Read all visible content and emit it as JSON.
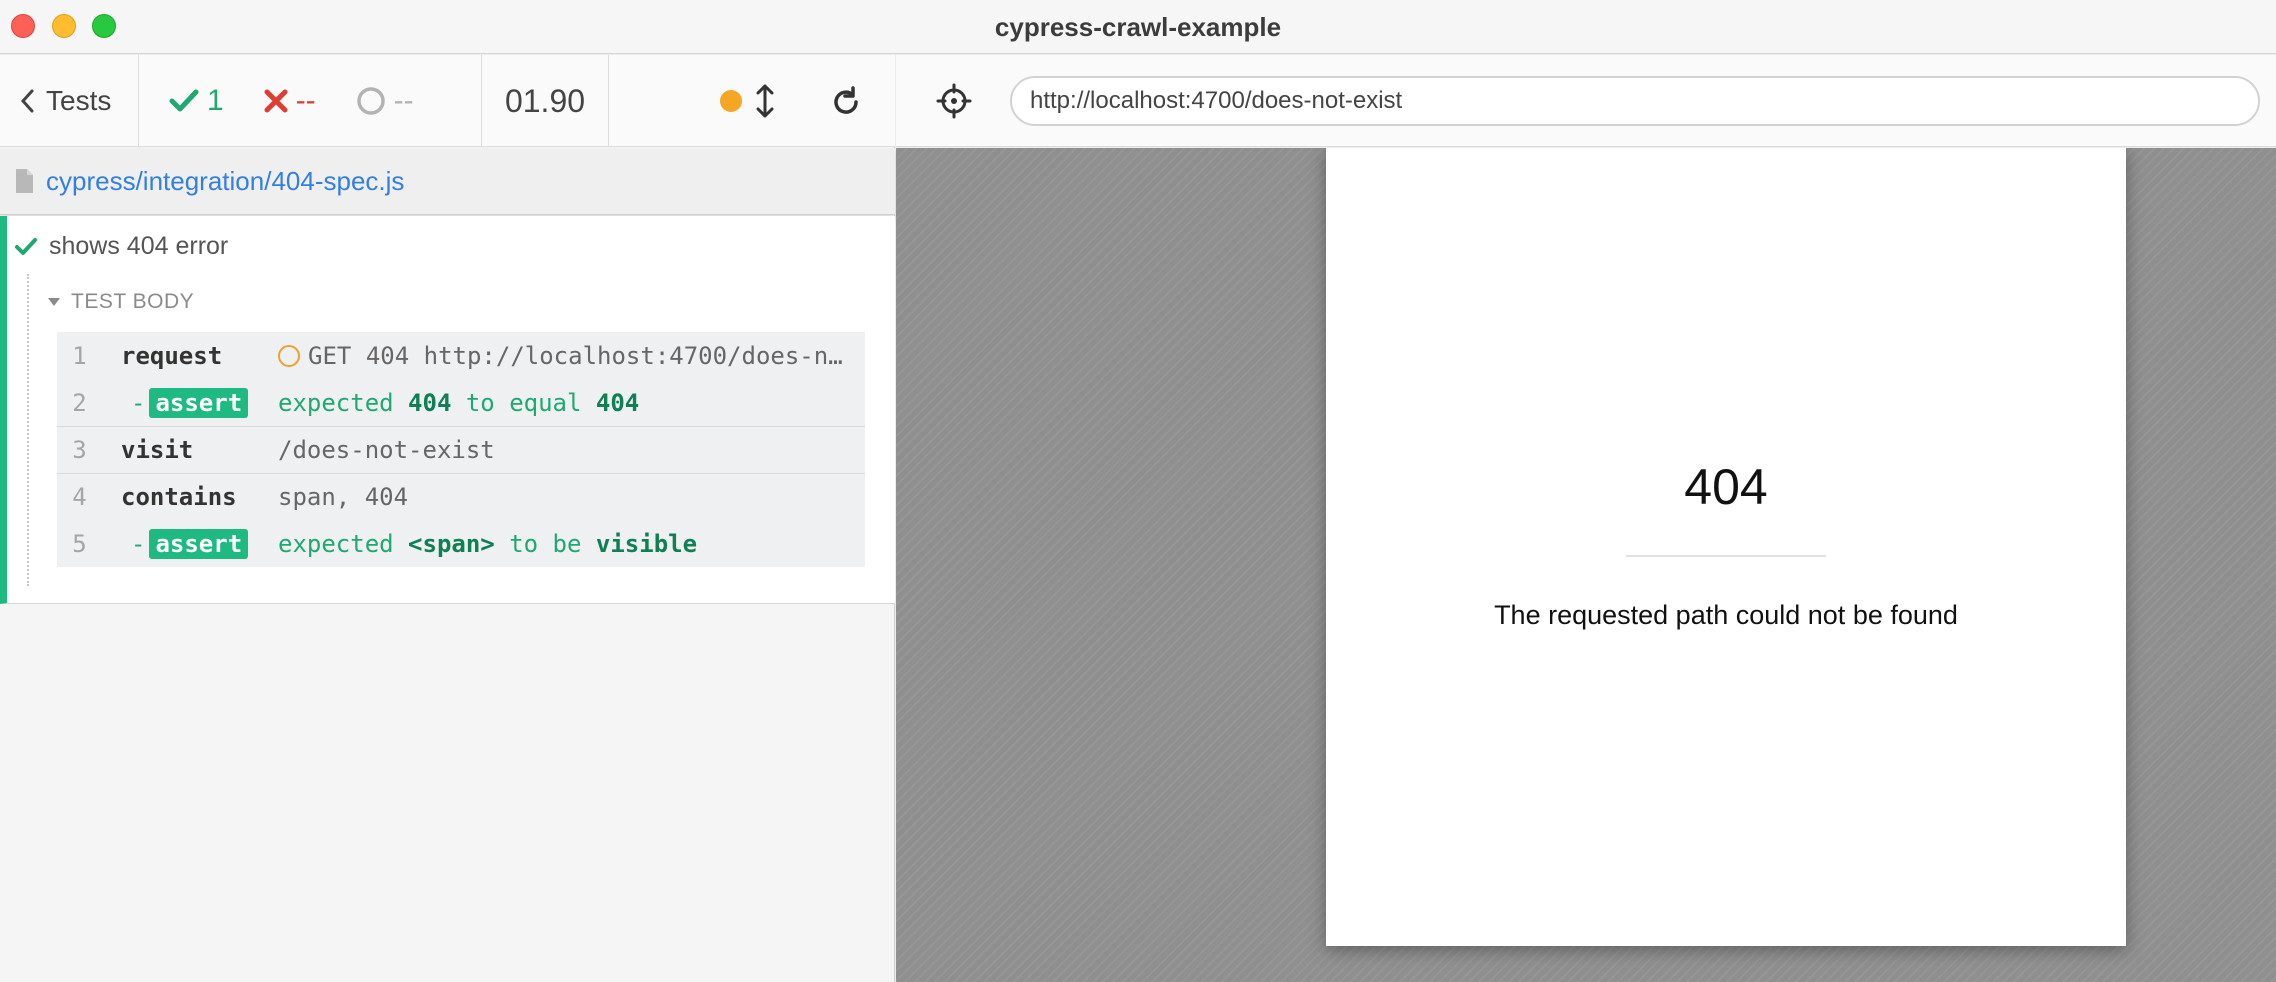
{
  "window": {
    "title": "cypress-crawl-example"
  },
  "reporter": {
    "tests_label": "Tests",
    "stats": {
      "passed": "1",
      "failed": "--",
      "pending": "--"
    },
    "duration": "01.90",
    "spec_path": "cypress/integration/404-spec.js",
    "test": {
      "title": "shows 404 error",
      "hook_title": "TEST BODY",
      "commands": [
        {
          "num": "1",
          "name": "request",
          "method": "GET",
          "status": "404",
          "url_text": "http://localhost:4700/does-n…"
        },
        {
          "num": "2",
          "assert": "assert",
          "expected": "expected",
          "value1": "404",
          "to_equal": "to equal",
          "value2": "404"
        },
        {
          "num": "3",
          "name": "visit",
          "message": "/does-not-exist"
        },
        {
          "num": "4",
          "name": "contains",
          "message": "span, 404"
        },
        {
          "num": "5",
          "assert": "assert",
          "expected": "expected",
          "subject": "<span>",
          "to_be": "to be",
          "state": "visible"
        }
      ]
    }
  },
  "aut": {
    "url": "http://localhost:4700/does-not-exist",
    "page": {
      "code": "404",
      "message": "The requested path could not be found"
    }
  },
  "colors": {
    "pass": "#1fa971",
    "fail": "#e03c31",
    "link": "#3380e0",
    "pending": "#f5a623"
  }
}
